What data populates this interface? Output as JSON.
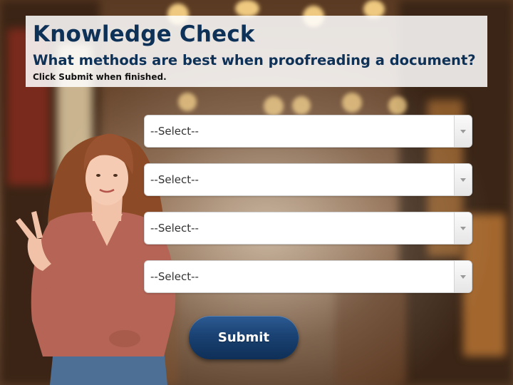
{
  "header": {
    "title": "Knowledge Check",
    "question": "What methods are best when proofreading a document?",
    "hint": "Click Submit when finished."
  },
  "dropdowns": [
    {
      "selected": "--Select--"
    },
    {
      "selected": "--Select--"
    },
    {
      "selected": "--Select--"
    },
    {
      "selected": "--Select--"
    }
  ],
  "submit": {
    "label": "Submit"
  },
  "colors": {
    "title": "#0e3157",
    "button": "#1a4273"
  }
}
